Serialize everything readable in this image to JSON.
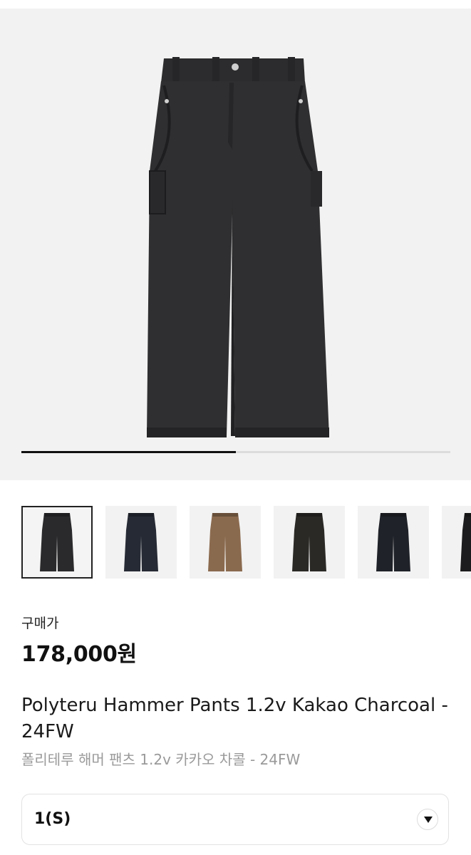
{
  "gallery": {
    "progress": 0.5,
    "thumbnails": [
      {
        "color": "#2a2a2c",
        "selected": true
      },
      {
        "color": "#262a34",
        "selected": false
      },
      {
        "color": "#8a6a4e",
        "selected": false
      },
      {
        "color": "#2b2926",
        "selected": false
      },
      {
        "color": "#1f2228",
        "selected": false
      },
      {
        "color": "#1c1c1e",
        "selected": false
      }
    ]
  },
  "product": {
    "price_label": "구매가",
    "price": "178,000원",
    "title_en": "Polyteru Hammer Pants 1.2v Kakao Charcoal - 24FW",
    "title_ko": "폴리테루 해머 팬츠 1.2v 카카오 차콜 - 24FW"
  },
  "option": {
    "selected_value": "1(S)"
  },
  "colors": {
    "hero_background": "#f2f2f2",
    "pants_main": "#2f2f31"
  }
}
